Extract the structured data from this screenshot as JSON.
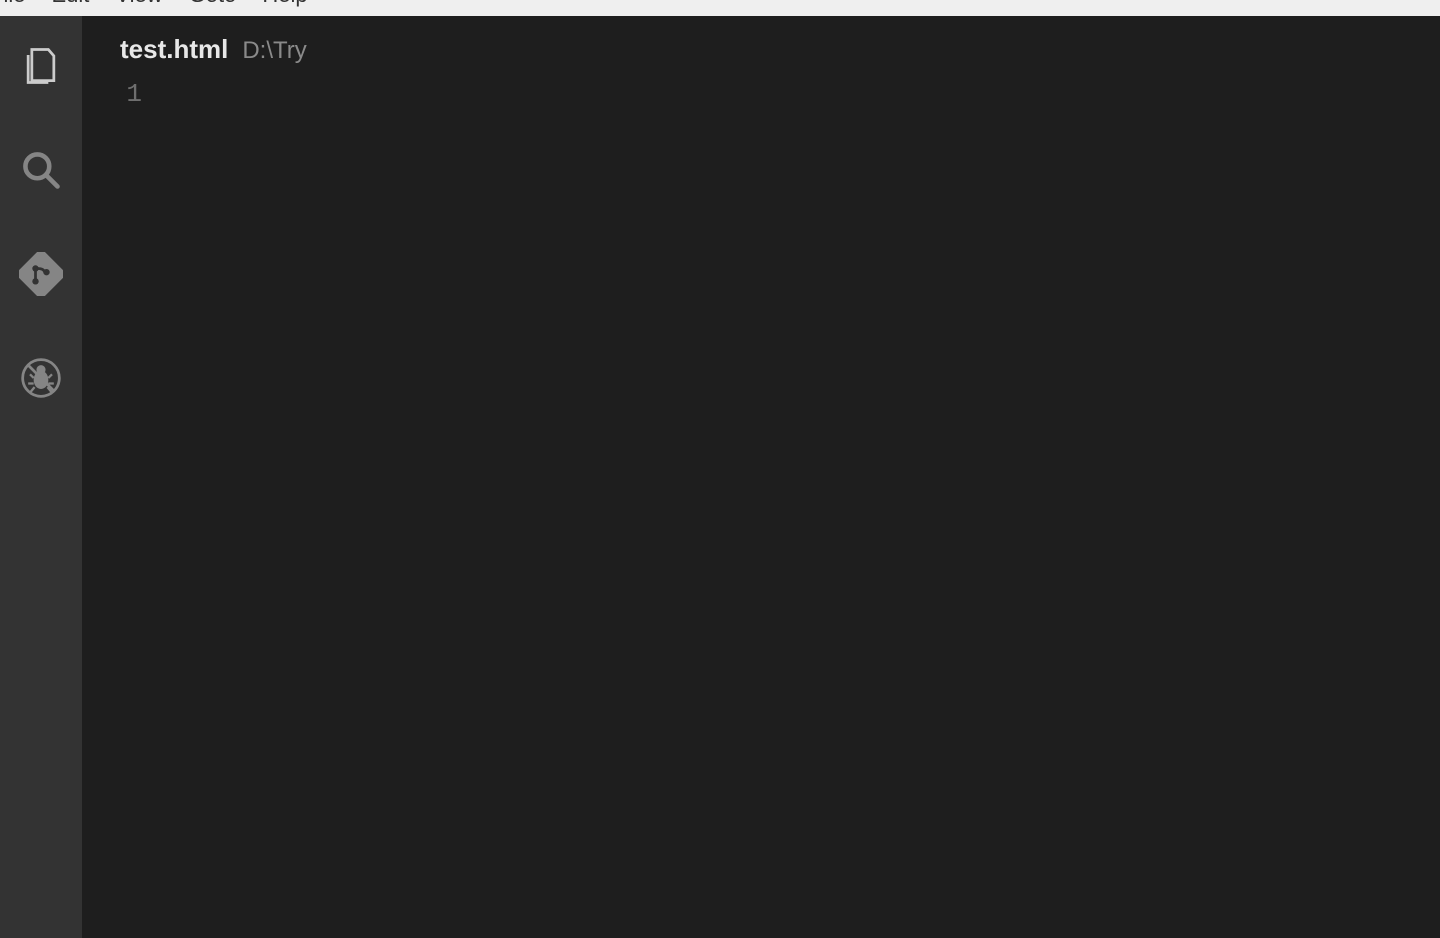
{
  "menubar": {
    "items": [
      "File",
      "Edit",
      "View",
      "Goto",
      "Help"
    ]
  },
  "activity_bar": {
    "explorer_icon": "files-icon",
    "search_icon": "search-icon",
    "source_control_icon": "git-icon",
    "debug_icon": "bug-icon"
  },
  "editor": {
    "tab": {
      "filename": "test.html",
      "path": "D:\\Try"
    },
    "lines": {
      "first_line_number": "1"
    },
    "content": ""
  }
}
